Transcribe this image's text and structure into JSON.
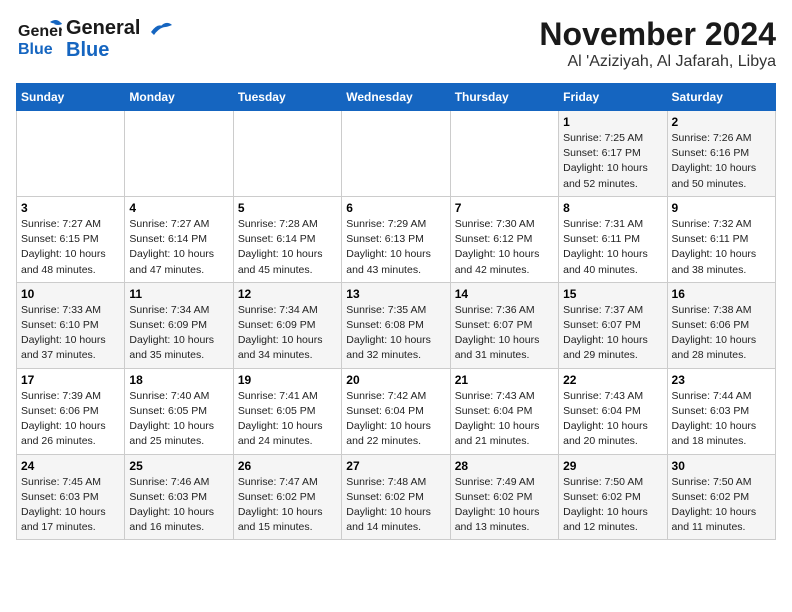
{
  "logo": {
    "line1": "General",
    "line2": "Blue"
  },
  "title": "November 2024",
  "location": "Al 'Aziziyah, Al Jafarah, Libya",
  "days_header": [
    "Sunday",
    "Monday",
    "Tuesday",
    "Wednesday",
    "Thursday",
    "Friday",
    "Saturday"
  ],
  "weeks": [
    [
      {
        "day": "",
        "text": ""
      },
      {
        "day": "",
        "text": ""
      },
      {
        "day": "",
        "text": ""
      },
      {
        "day": "",
        "text": ""
      },
      {
        "day": "",
        "text": ""
      },
      {
        "day": "1",
        "text": "Sunrise: 7:25 AM\nSunset: 6:17 PM\nDaylight: 10 hours\nand 52 minutes."
      },
      {
        "day": "2",
        "text": "Sunrise: 7:26 AM\nSunset: 6:16 PM\nDaylight: 10 hours\nand 50 minutes."
      }
    ],
    [
      {
        "day": "3",
        "text": "Sunrise: 7:27 AM\nSunset: 6:15 PM\nDaylight: 10 hours\nand 48 minutes."
      },
      {
        "day": "4",
        "text": "Sunrise: 7:27 AM\nSunset: 6:14 PM\nDaylight: 10 hours\nand 47 minutes."
      },
      {
        "day": "5",
        "text": "Sunrise: 7:28 AM\nSunset: 6:14 PM\nDaylight: 10 hours\nand 45 minutes."
      },
      {
        "day": "6",
        "text": "Sunrise: 7:29 AM\nSunset: 6:13 PM\nDaylight: 10 hours\nand 43 minutes."
      },
      {
        "day": "7",
        "text": "Sunrise: 7:30 AM\nSunset: 6:12 PM\nDaylight: 10 hours\nand 42 minutes."
      },
      {
        "day": "8",
        "text": "Sunrise: 7:31 AM\nSunset: 6:11 PM\nDaylight: 10 hours\nand 40 minutes."
      },
      {
        "day": "9",
        "text": "Sunrise: 7:32 AM\nSunset: 6:11 PM\nDaylight: 10 hours\nand 38 minutes."
      }
    ],
    [
      {
        "day": "10",
        "text": "Sunrise: 7:33 AM\nSunset: 6:10 PM\nDaylight: 10 hours\nand 37 minutes."
      },
      {
        "day": "11",
        "text": "Sunrise: 7:34 AM\nSunset: 6:09 PM\nDaylight: 10 hours\nand 35 minutes."
      },
      {
        "day": "12",
        "text": "Sunrise: 7:34 AM\nSunset: 6:09 PM\nDaylight: 10 hours\nand 34 minutes."
      },
      {
        "day": "13",
        "text": "Sunrise: 7:35 AM\nSunset: 6:08 PM\nDaylight: 10 hours\nand 32 minutes."
      },
      {
        "day": "14",
        "text": "Sunrise: 7:36 AM\nSunset: 6:07 PM\nDaylight: 10 hours\nand 31 minutes."
      },
      {
        "day": "15",
        "text": "Sunrise: 7:37 AM\nSunset: 6:07 PM\nDaylight: 10 hours\nand 29 minutes."
      },
      {
        "day": "16",
        "text": "Sunrise: 7:38 AM\nSunset: 6:06 PM\nDaylight: 10 hours\nand 28 minutes."
      }
    ],
    [
      {
        "day": "17",
        "text": "Sunrise: 7:39 AM\nSunset: 6:06 PM\nDaylight: 10 hours\nand 26 minutes."
      },
      {
        "day": "18",
        "text": "Sunrise: 7:40 AM\nSunset: 6:05 PM\nDaylight: 10 hours\nand 25 minutes."
      },
      {
        "day": "19",
        "text": "Sunrise: 7:41 AM\nSunset: 6:05 PM\nDaylight: 10 hours\nand 24 minutes."
      },
      {
        "day": "20",
        "text": "Sunrise: 7:42 AM\nSunset: 6:04 PM\nDaylight: 10 hours\nand 22 minutes."
      },
      {
        "day": "21",
        "text": "Sunrise: 7:43 AM\nSunset: 6:04 PM\nDaylight: 10 hours\nand 21 minutes."
      },
      {
        "day": "22",
        "text": "Sunrise: 7:43 AM\nSunset: 6:04 PM\nDaylight: 10 hours\nand 20 minutes."
      },
      {
        "day": "23",
        "text": "Sunrise: 7:44 AM\nSunset: 6:03 PM\nDaylight: 10 hours\nand 18 minutes."
      }
    ],
    [
      {
        "day": "24",
        "text": "Sunrise: 7:45 AM\nSunset: 6:03 PM\nDaylight: 10 hours\nand 17 minutes."
      },
      {
        "day": "25",
        "text": "Sunrise: 7:46 AM\nSunset: 6:03 PM\nDaylight: 10 hours\nand 16 minutes."
      },
      {
        "day": "26",
        "text": "Sunrise: 7:47 AM\nSunset: 6:02 PM\nDaylight: 10 hours\nand 15 minutes."
      },
      {
        "day": "27",
        "text": "Sunrise: 7:48 AM\nSunset: 6:02 PM\nDaylight: 10 hours\nand 14 minutes."
      },
      {
        "day": "28",
        "text": "Sunrise: 7:49 AM\nSunset: 6:02 PM\nDaylight: 10 hours\nand 13 minutes."
      },
      {
        "day": "29",
        "text": "Sunrise: 7:50 AM\nSunset: 6:02 PM\nDaylight: 10 hours\nand 12 minutes."
      },
      {
        "day": "30",
        "text": "Sunrise: 7:50 AM\nSunset: 6:02 PM\nDaylight: 10 hours\nand 11 minutes."
      }
    ]
  ]
}
